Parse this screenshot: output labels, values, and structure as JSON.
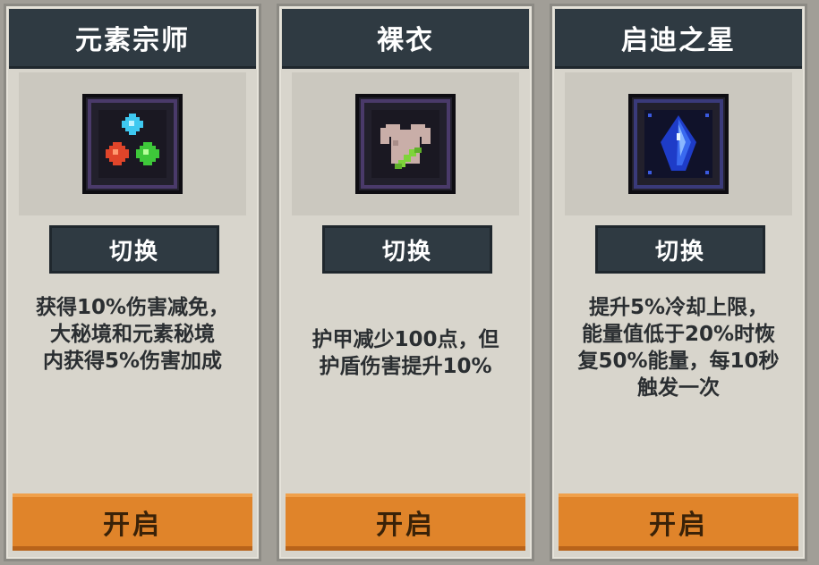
{
  "cards": [
    {
      "title": "元素宗师",
      "icon": "elemental-orbs-icon",
      "switch_label": "切换",
      "description": "获得10%伤害减免，\n大秘境和元素秘境\n内获得5%伤害加成",
      "open_label": "开启"
    },
    {
      "title": "裸衣",
      "icon": "bare-armor-icon",
      "switch_label": "切换",
      "description": "护甲减少100点，但\n护盾伤害提升10%",
      "open_label": "开启"
    },
    {
      "title": "启迪之星",
      "icon": "blue-star-crystal-icon",
      "switch_label": "切换",
      "description": "提升5%冷却上限，\n能量值低于20%时恢\n复50%能量，每10秒\n触发一次",
      "open_label": "开启"
    }
  ],
  "colors": {
    "header": "#2f3a42",
    "card_bg": "#d8d5cc",
    "open_button": "#e0842a",
    "text": "#2a2e31"
  }
}
